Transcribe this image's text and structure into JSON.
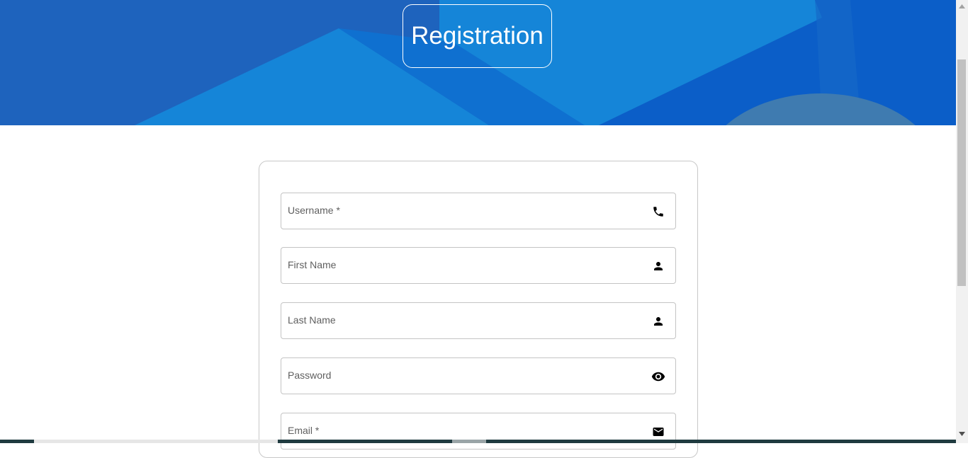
{
  "header": {
    "title": "Registration",
    "colors": {
      "base": "#1e63bd",
      "light": "#1585d8",
      "mid": "#0f70d0",
      "dark": "#0b5ec8",
      "circle": "#3f7bb0"
    }
  },
  "form": {
    "fields": [
      {
        "label": "Username *",
        "icon": "phone-icon"
      },
      {
        "label": "First Name",
        "icon": "person-icon"
      },
      {
        "label": "Last Name",
        "icon": "person-icon"
      },
      {
        "label": "Password",
        "icon": "eye-icon"
      },
      {
        "label": "Email *",
        "icon": "mail-icon"
      }
    ]
  },
  "scrollbar": {
    "up_arrow": "up-arrow-icon",
    "down_arrow": "down-arrow-icon"
  }
}
